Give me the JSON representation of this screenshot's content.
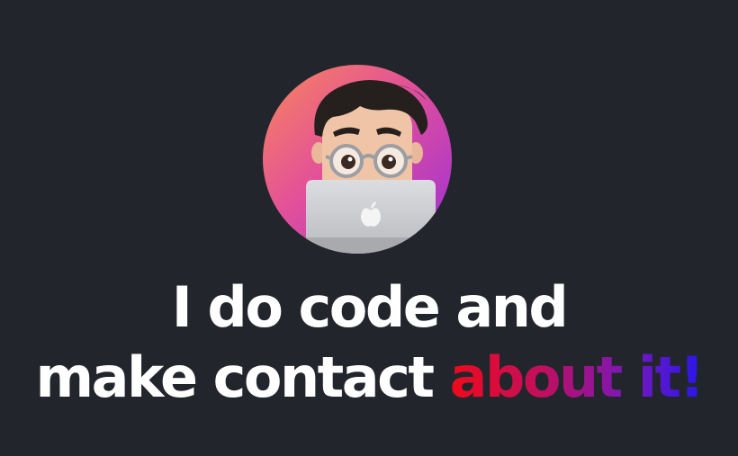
{
  "hero": {
    "avatar_icon": "memoji-laptop-avatar-icon",
    "headline": {
      "line1": "I do code and",
      "line2_plain": "make contact ",
      "line2_accent": "about it!"
    },
    "colors": {
      "background": "#22252b",
      "text": "#ffffff",
      "accent_gradient": [
        "#ef0a1c",
        "#c30f5a",
        "#7a18b8",
        "#2a16ea"
      ],
      "avatar_gradient": [
        "#f77b5c",
        "#e24d9e",
        "#a02fd6"
      ]
    }
  }
}
